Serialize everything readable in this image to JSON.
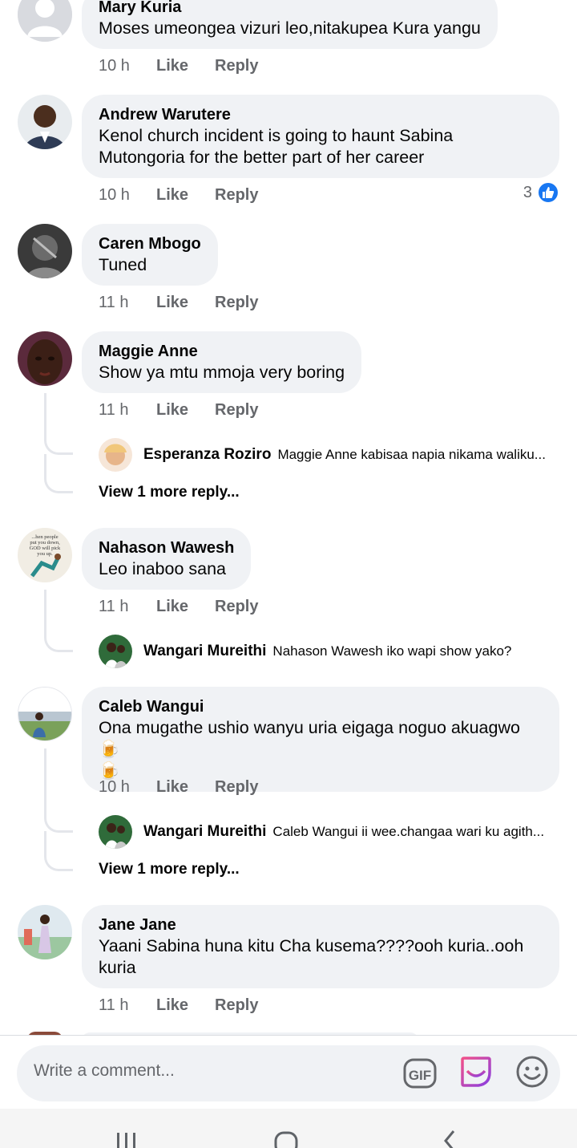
{
  "comments": [
    {
      "author": "Mary Kuria",
      "lines": [
        "Moses umeongea vizuri leo,nitakupea Kura yangu"
      ],
      "time": "10 h",
      "like": "Like",
      "reply": "Reply"
    },
    {
      "author": "Andrew Warutere",
      "lines": [
        "Kenol church incident is going to haunt Sabina",
        "Mutongoria for the better part of her career"
      ],
      "time": "10 h",
      "like": "Like",
      "reply": "Reply",
      "reaction_count": "3"
    },
    {
      "author": "Caren Mbogo",
      "lines": [
        "Tuned"
      ],
      "time": "11 h",
      "like": "Like",
      "reply": "Reply"
    },
    {
      "author": "Maggie Anne",
      "lines": [
        "Show ya mtu mmoja very boring"
      ],
      "time": "11 h",
      "like": "Like",
      "reply": "Reply",
      "reply_preview": {
        "author": "Esperanza Roziro",
        "text": "Maggie Anne kabisaa napia nikama waliku..."
      },
      "more_replies": "View 1 more reply..."
    },
    {
      "author": "Nahason Wawesh",
      "lines": [
        "Leo inaboo sana"
      ],
      "time": "11 h",
      "like": "Like",
      "reply": "Reply",
      "avatar_text": [
        "...hen people",
        "put you down,",
        "GOD will pick",
        "you up."
      ],
      "reply_preview": {
        "author": "Wangari Mureithi",
        "text": "Nahason Wawesh iko wapi show yako?"
      }
    },
    {
      "author": "Caleb Wangui",
      "lines": [
        "Ona mugathe ushio wanyu uria eigaga noguo akuagwo 🍺",
        "🍺"
      ],
      "time": "10 h",
      "like": "Like",
      "reply": "Reply",
      "reply_preview": {
        "author": "Wangari Mureithi",
        "text": "Caleb Wangui ii wee.changaa wari ku agith..."
      },
      "more_replies": "View 1 more reply..."
    },
    {
      "author": "Jane Jane",
      "lines": [
        "Yaani Sabina huna kitu Cha kusema????ooh kuria..ooh",
        "kuria"
      ],
      "time": "11 h",
      "like": "Like",
      "reply": "Reply"
    }
  ],
  "composer": {
    "placeholder": "Write a comment..."
  },
  "icons": {
    "gif": "gif-icon",
    "sticker": "sticker-icon",
    "emoji": "emoji-icon",
    "like_reaction": "thumbs-up-icon"
  },
  "colors": {
    "like_blue": "#1877f2",
    "bubble": "#f0f2f5",
    "meta_gray": "#65676b"
  }
}
